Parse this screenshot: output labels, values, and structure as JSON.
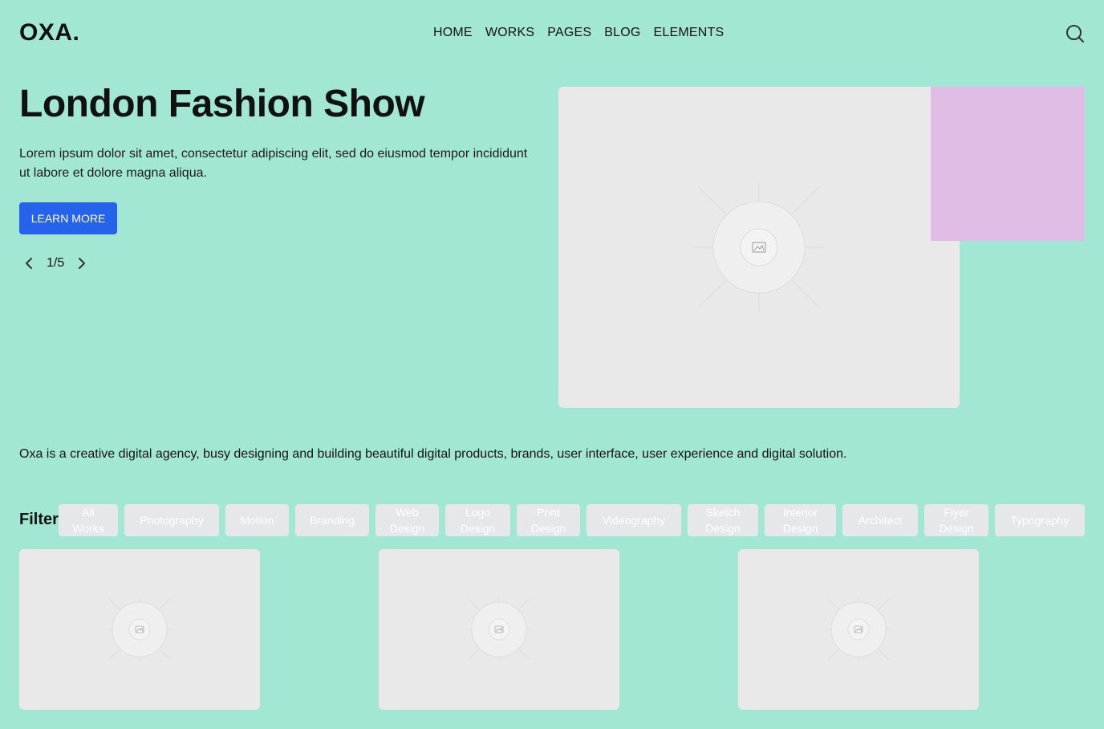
{
  "header": {
    "logo": "OXA.",
    "nav": [
      "HOME",
      "WORKS",
      "PAGES",
      "BLOG",
      "ELEMENTS"
    ]
  },
  "hero": {
    "title": "London Fashion Show",
    "description": "Lorem ipsum dolor sit amet, consectetur adipiscing elit, sed do eiusmod tempor incididunt ut labore et dolore magna aliqua.",
    "cta_label": "LEARN MORE",
    "pager": "1/5"
  },
  "about": "Oxa is a creative digital agency, busy designing and building beautiful digital products, brands, user interface, user experience and digital solution.",
  "filter": {
    "label": "Filter",
    "chips": [
      "All Works",
      "Photography",
      "Motion",
      "Branding",
      "Web Design",
      "Logo Design",
      "Print Design",
      "Videography",
      "Sketch Design",
      "Interior Design",
      "Architect",
      "Flyer Design",
      "Typography"
    ]
  },
  "colors": {
    "background": "#a2e6d4",
    "primary_button": "#2563eb",
    "accent_square": "#e0bde4",
    "image_placeholder": "#e9e9e9",
    "chip_background": "#e5e7eb"
  },
  "icons": {
    "search": "search-icon",
    "prev": "chevron-left-icon",
    "next": "chevron-right-icon",
    "image": "image-icon"
  }
}
